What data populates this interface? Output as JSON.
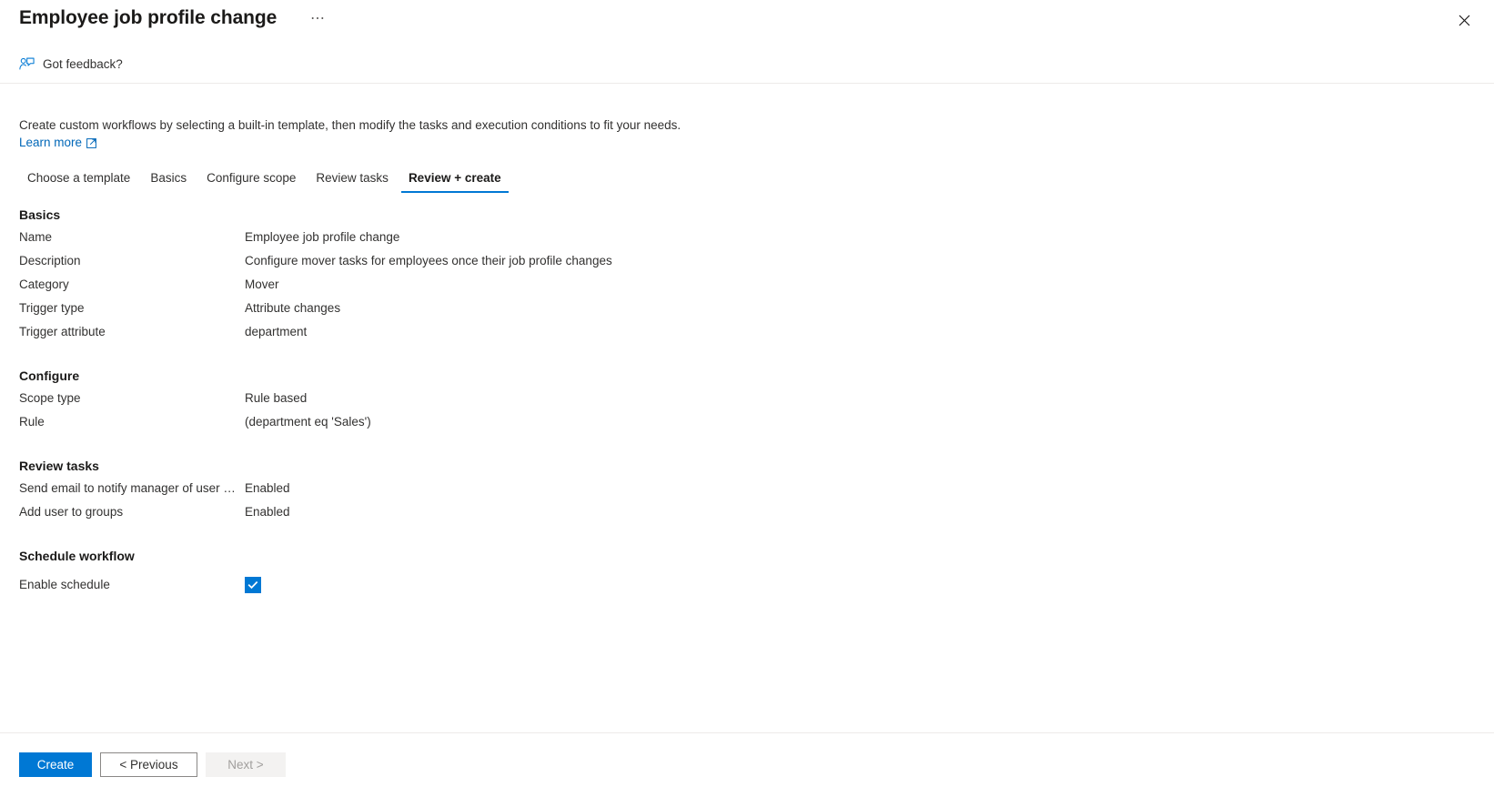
{
  "header": {
    "title": "Employee job profile change",
    "ellipsis_label": "⋯",
    "close_icon": "close-icon"
  },
  "command_bar": {
    "feedback_label": "Got feedback?",
    "feedback_icon": "feedback-person-icon"
  },
  "intro": {
    "text": "Create custom workflows by selecting a built-in template, then modify the tasks and execution conditions to fit your needs.",
    "learn_more_label": "Learn more",
    "external_icon": "external-link-icon"
  },
  "tabs": [
    {
      "label": "Choose a template",
      "active": false
    },
    {
      "label": "Basics",
      "active": false
    },
    {
      "label": "Configure scope",
      "active": false
    },
    {
      "label": "Review tasks",
      "active": false
    },
    {
      "label": "Review + create",
      "active": true
    }
  ],
  "sections": {
    "basics": {
      "heading": "Basics",
      "rows": [
        {
          "key": "Name",
          "value": "Employee job profile change"
        },
        {
          "key": "Description",
          "value": "Configure mover tasks for employees once their job profile changes"
        },
        {
          "key": "Category",
          "value": "Mover"
        },
        {
          "key": "Trigger type",
          "value": "Attribute changes"
        },
        {
          "key": "Trigger attribute",
          "value": "department"
        }
      ]
    },
    "configure": {
      "heading": "Configure",
      "rows": [
        {
          "key": "Scope type",
          "value": "Rule based"
        },
        {
          "key": "Rule",
          "value": "(department eq 'Sales')"
        }
      ]
    },
    "review_tasks": {
      "heading": "Review tasks",
      "rows": [
        {
          "key": "Send email to notify manager of user mo…",
          "value": "Enabled"
        },
        {
          "key": "Add user to groups",
          "value": "Enabled"
        }
      ]
    },
    "schedule": {
      "heading": "Schedule workflow",
      "checkbox_label": "Enable schedule",
      "checkbox_checked": true
    }
  },
  "footer": {
    "create_label": "Create",
    "previous_label": "< Previous",
    "next_label": "Next >"
  },
  "colors": {
    "accent": "#0078d4",
    "link": "#0067b8",
    "text": "#323130",
    "divider": "#edebe9"
  }
}
